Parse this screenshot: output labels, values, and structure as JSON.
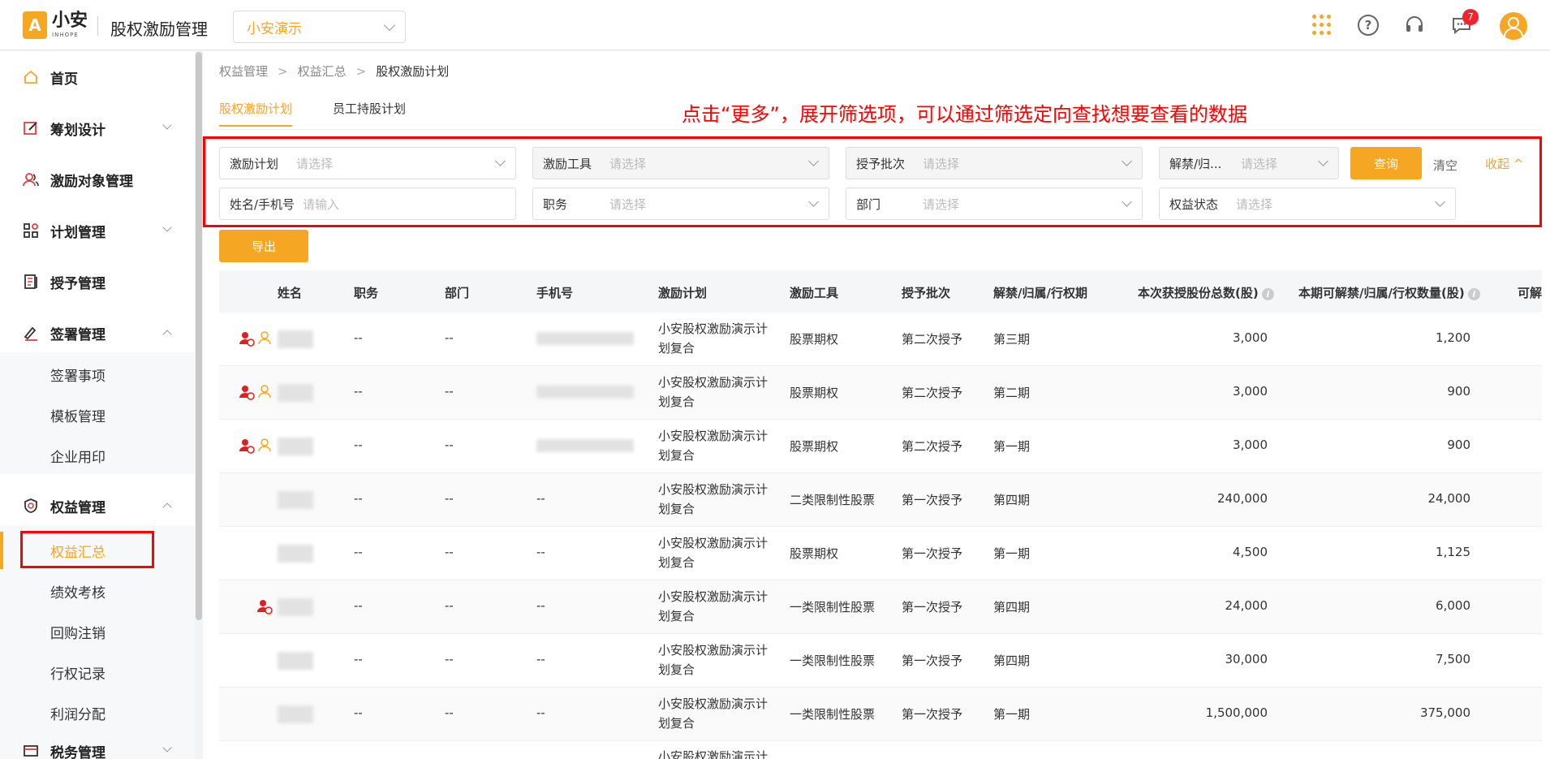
{
  "header": {
    "logo_mark": "A",
    "logo_cn": "小安",
    "logo_en": "INHOPE",
    "app_title": "股权激励管理",
    "company": "小安演示",
    "help_glyph": "?",
    "msg_badge": "7",
    "icons": [
      "apps-grid-icon",
      "help-icon",
      "support-headset-icon",
      "message-icon",
      "user-avatar-icon"
    ]
  },
  "sidebar": {
    "items": [
      {
        "label": "首页",
        "icon": "home-icon"
      },
      {
        "label": "筹划设计",
        "icon": "edit-icon"
      },
      {
        "label": "激励对象管理",
        "icon": "users-icon"
      },
      {
        "label": "计划管理",
        "icon": "apps-icon"
      },
      {
        "label": "授予管理",
        "icon": "ledger-icon"
      },
      {
        "label": "签署管理",
        "icon": "sign-icon"
      },
      {
        "label": "权益管理",
        "icon": "badge-icon"
      },
      {
        "label": "税务管理",
        "icon": "tax-icon"
      }
    ],
    "sign_sub": [
      "签署事项",
      "模板管理",
      "企业用印"
    ],
    "equity_sub": [
      "权益汇总",
      "绩效考核",
      "回购注销",
      "行权记录",
      "利润分配"
    ]
  },
  "breadcrumb": [
    "权益管理",
    "权益汇总",
    "股权激励计划"
  ],
  "breadcrumb_sep": ">",
  "tabs": [
    "股权激励计划",
    "员工持股计划"
  ],
  "annotation": "点击“更多”，展开筛选项，可以通过筛选定向查找想要查看的数据",
  "filters": {
    "row1": [
      {
        "label": "激励计划",
        "placeholder": "请选择"
      },
      {
        "label": "激励工具",
        "placeholder": "请选择"
      },
      {
        "label": "授予批次",
        "placeholder": "请选择"
      },
      {
        "label": "解禁/归...",
        "placeholder": "请选择"
      }
    ],
    "row2": [
      {
        "label": "姓名/手机号",
        "placeholder": "请输入"
      },
      {
        "label": "职务",
        "placeholder": "请选择"
      },
      {
        "label": "部门",
        "placeholder": "请选择"
      },
      {
        "label": "权益状态",
        "placeholder": "请选择"
      }
    ],
    "query": "查询",
    "clear": "清空",
    "collapse": "收起 ^"
  },
  "export": "导出",
  "table": {
    "columns": [
      "姓名",
      "职务",
      "部门",
      "手机号",
      "激励计划",
      "激励工具",
      "授予批次",
      "解禁/归属/行权期",
      "本次获授股份总数(股)",
      "本期可解禁/归属/行权数量(股)",
      "可解"
    ],
    "info_glyph": "i",
    "rows": [
      {
        "title": "--",
        "dept": "--",
        "phone": "",
        "plan": "小安股权激励演示计划复合",
        "tool": "股票期权",
        "batch": "第二次授予",
        "period": "第三期",
        "total": "3,000",
        "current": "1,200"
      },
      {
        "title": "--",
        "dept": "--",
        "phone": "",
        "plan": "小安股权激励演示计划复合",
        "tool": "股票期权",
        "batch": "第二次授予",
        "period": "第二期",
        "total": "3,000",
        "current": "900"
      },
      {
        "title": "--",
        "dept": "--",
        "phone": "",
        "plan": "小安股权激励演示计划复合",
        "tool": "股票期权",
        "batch": "第二次授予",
        "period": "第一期",
        "total": "3,000",
        "current": "900"
      },
      {
        "title": "--",
        "dept": "--",
        "phone": "--",
        "plan": "小安股权激励演示计划复合",
        "tool": "二类限制性股票",
        "batch": "第一次授予",
        "period": "第四期",
        "total": "240,000",
        "current": "24,000"
      },
      {
        "title": "--",
        "dept": "--",
        "phone": "--",
        "plan": "小安股权激励演示计划复合",
        "tool": "股票期权",
        "batch": "第一次授予",
        "period": "第一期",
        "total": "4,500",
        "current": "1,125"
      },
      {
        "title": "--",
        "dept": "--",
        "phone": "--",
        "plan": "小安股权激励演示计划复合",
        "tool": "一类限制性股票",
        "batch": "第一次授予",
        "period": "第四期",
        "total": "24,000",
        "current": "6,000"
      },
      {
        "title": "--",
        "dept": "--",
        "phone": "--",
        "plan": "小安股权激励演示计划复合",
        "tool": "一类限制性股票",
        "batch": "第一次授予",
        "period": "第四期",
        "total": "30,000",
        "current": "7,500"
      },
      {
        "title": "--",
        "dept": "--",
        "phone": "--",
        "plan": "小安股权激励演示计划复合",
        "tool": "一类限制性股票",
        "batch": "第一次授予",
        "period": "第一期",
        "total": "1,500,000",
        "current": "375,000"
      }
    ],
    "partial_row_plan": "小安股权激励演示计"
  },
  "colors": {
    "accent": "#f5a623",
    "annotation": "#ff0000",
    "user_red": "#e02020"
  }
}
